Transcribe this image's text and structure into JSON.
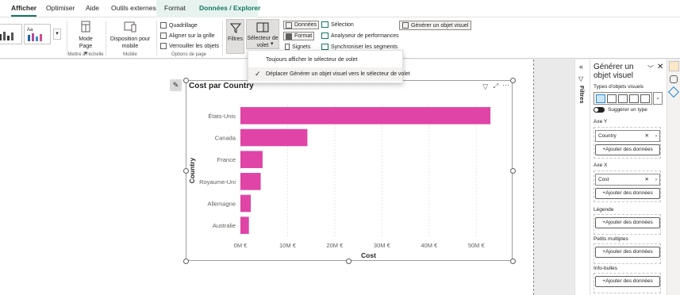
{
  "tabs": [
    "Afficher",
    "Optimiser",
    "Aide",
    "Outils externes",
    "Format",
    "Données / Explorer"
  ],
  "ribbon": {
    "mobile_layout": "Mode Page",
    "mobile_layout_arrow": "▾",
    "mobile_disposition": "Disposition pour mobile",
    "group_scale": "Mettre à l'échelle",
    "group_mobile": "Mobile",
    "gridlines": "Quadrillage",
    "snap": "Aligner sur la grille",
    "lock": "Verrouiller les objets",
    "group_page": "Options de page",
    "filters": "Filtres",
    "pane_selector": "Sélecteur de volet",
    "pane_selector_arrow": "▾",
    "data": "Données",
    "format": "Format",
    "bookmarks": "Signets",
    "selection": "Sélection",
    "perf": "Analyseur de performances",
    "sync": "Synchroniser les segments",
    "build_visual": "Générer un objet visuel"
  },
  "dropdown": {
    "item1": "Toujours afficher le sélecteur de volet",
    "item2": "Déplacer Générer un objet visuel vers le sélecteur de volet"
  },
  "visual": {
    "title": "Cost par Country"
  },
  "chart_data": {
    "type": "bar",
    "orientation": "horizontal",
    "categories": [
      "États-Unis",
      "Canada",
      "France",
      "Royaume-Uni",
      "Allemagne",
      "Australie"
    ],
    "values": [
      53,
      14.2,
      4.7,
      4.3,
      2.2,
      1.8
    ],
    "xlabel": "Cost",
    "ylabel": "Country",
    "xticks": [
      "0M €",
      "10M €",
      "20M €",
      "30M €",
      "40M €",
      "50M €"
    ],
    "xlim": [
      0,
      55
    ],
    "color": "#e044a7"
  },
  "pane": {
    "title": "Générer un objet visuel",
    "types_label": "Types d'objets visuels",
    "suggest": "Suggérer un type",
    "axis_y": "Axe Y",
    "axis_y_field": "Country",
    "axis_x": "Axe X",
    "axis_x_field": "Cost",
    "legend": "Légende",
    "small_multiples": "Petits multiples",
    "tooltips": "Info-bulles",
    "add_data": "+Ajouter des données",
    "filters_label": "Filtres"
  },
  "colors": {
    "accent": "#117865",
    "bar": "#e044a7"
  }
}
